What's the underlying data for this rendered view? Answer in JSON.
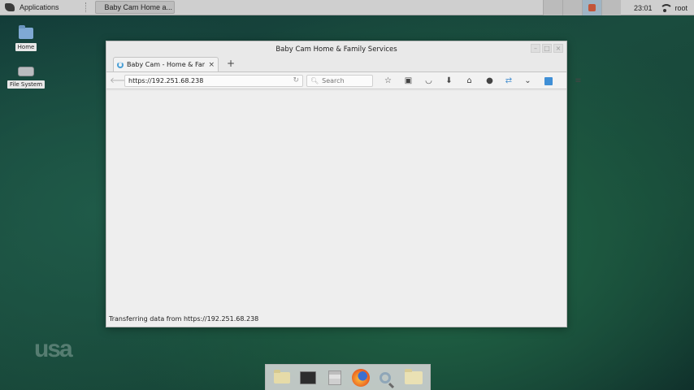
{
  "top_panel": {
    "applications_label": "Applications",
    "task_title": "Baby Cam Home a...",
    "clock": "23:01",
    "user": "root"
  },
  "desktop": {
    "icons": [
      {
        "label": "Home",
        "icon": "folder-icon"
      },
      {
        "label": "File System",
        "icon": "drive-icon"
      }
    ]
  },
  "browser": {
    "window_title": "Baby Cam Home & Family Services",
    "tab": {
      "title": "Baby Cam - Home & Family...",
      "close": "×"
    },
    "new_tab": "+",
    "url": "https://192.251.68.238",
    "search_placeholder": "Search",
    "status_text": "Transferring data from  https://192.251.68.238"
  },
  "watermark": "usa",
  "colors": {
    "desktop": "#1d5a40",
    "panel": "#cfcfcf",
    "accent_blue": "#3f8fd6"
  }
}
